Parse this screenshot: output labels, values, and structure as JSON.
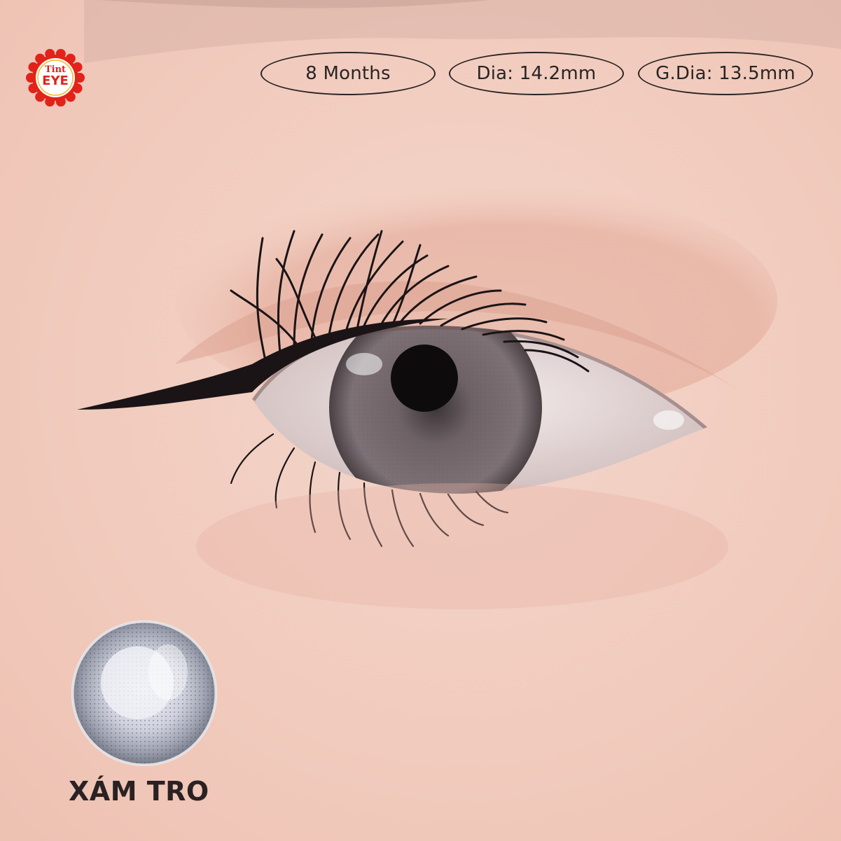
{
  "brand": {
    "logo_line1": "Tint",
    "logo_line2": "EYE",
    "logo_primary_color": "#e2231a",
    "logo_accent_color": "#f5b81f"
  },
  "specs": {
    "duration": "8 Months",
    "diameter": "Dia: 14.2mm",
    "graphic_diameter": "G.Dia: 13.5mm"
  },
  "product": {
    "name": "XÁM TRO",
    "lens_color": "#b9bcc9"
  },
  "palette": {
    "background": "#f3cfc3",
    "text": "#2a2424"
  }
}
